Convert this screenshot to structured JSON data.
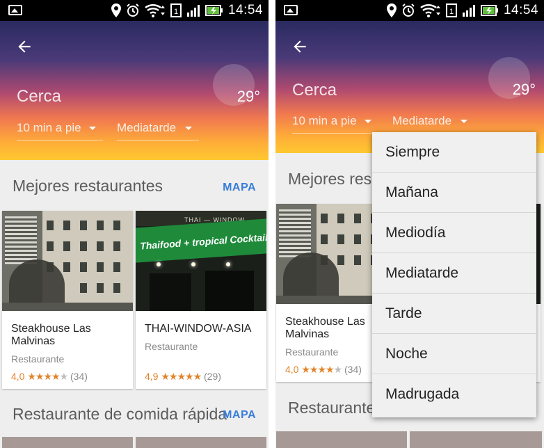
{
  "status_bar": {
    "time": "14:54"
  },
  "left_screen": {
    "hero": {
      "title": "Cerca",
      "temperature": "29°",
      "distance_filter": "10 min a pie",
      "time_filter": "Mediatarde"
    },
    "sections": [
      {
        "title": "Mejores restaurantes",
        "action": "MAPA"
      },
      {
        "title": "Restaurante de comida rápida",
        "action": "MAPA"
      }
    ],
    "cards": [
      {
        "name": "Steakhouse Las Malvinas",
        "type": "Restaurante",
        "rating": "4,0",
        "stars": "★★★★",
        "stars_empty": "★",
        "reviews": "(34)"
      },
      {
        "name": "THAI-WINDOW-ASIA",
        "type": "Restaurante",
        "rating": "4,9",
        "stars": "★★★★★",
        "stars_empty": "",
        "reviews": "(29)",
        "sign_text": "Thaifood + tropical Cocktails",
        "top_sign": "THAI — WINDOW — ASIA"
      }
    ]
  },
  "right_screen": {
    "hero": {
      "title": "Cerca",
      "temperature": "29°",
      "distance_filter": "10 min a pie",
      "time_filter": "Mediatarde"
    },
    "sections": [
      {
        "title": "Mejores res"
      },
      {
        "title": "Restaurante de"
      }
    ],
    "card": {
      "name": "Steakhouse Las Malvinas",
      "type": "Restaurante",
      "rating": "4,0",
      "stars": "★★★★",
      "stars_empty": "★",
      "reviews": "(34)"
    },
    "dropdown_menu": [
      "Siempre",
      "Mañana",
      "Mediodía",
      "Mediatarde",
      "Tarde",
      "Noche",
      "Madrugada"
    ]
  }
}
